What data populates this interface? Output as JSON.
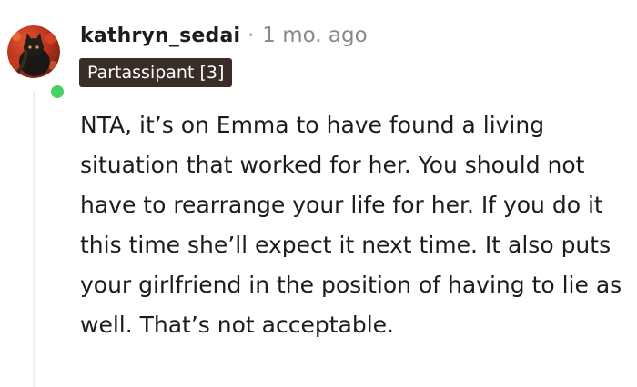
{
  "comment": {
    "author": "kathryn_sedai",
    "separator": "·",
    "timestamp": "1 mo. ago",
    "flair": "Partassipant [3]",
    "body": "NTA, it’s on Emma to have found a living situation that worked for her. You should not have to rearrange your life for her. If you do it this time she’ll expect it next time. It also puts your girlfriend in the position of having to lie as well. That’s not acceptable.",
    "author_online": true
  },
  "colors": {
    "online_indicator": "#46d160",
    "flair_background": "#3a2d27",
    "meta_text": "#878a8c",
    "thread_line": "#edeff1"
  },
  "icons": {
    "avatar": "user-avatar",
    "online": "online-status-dot"
  }
}
